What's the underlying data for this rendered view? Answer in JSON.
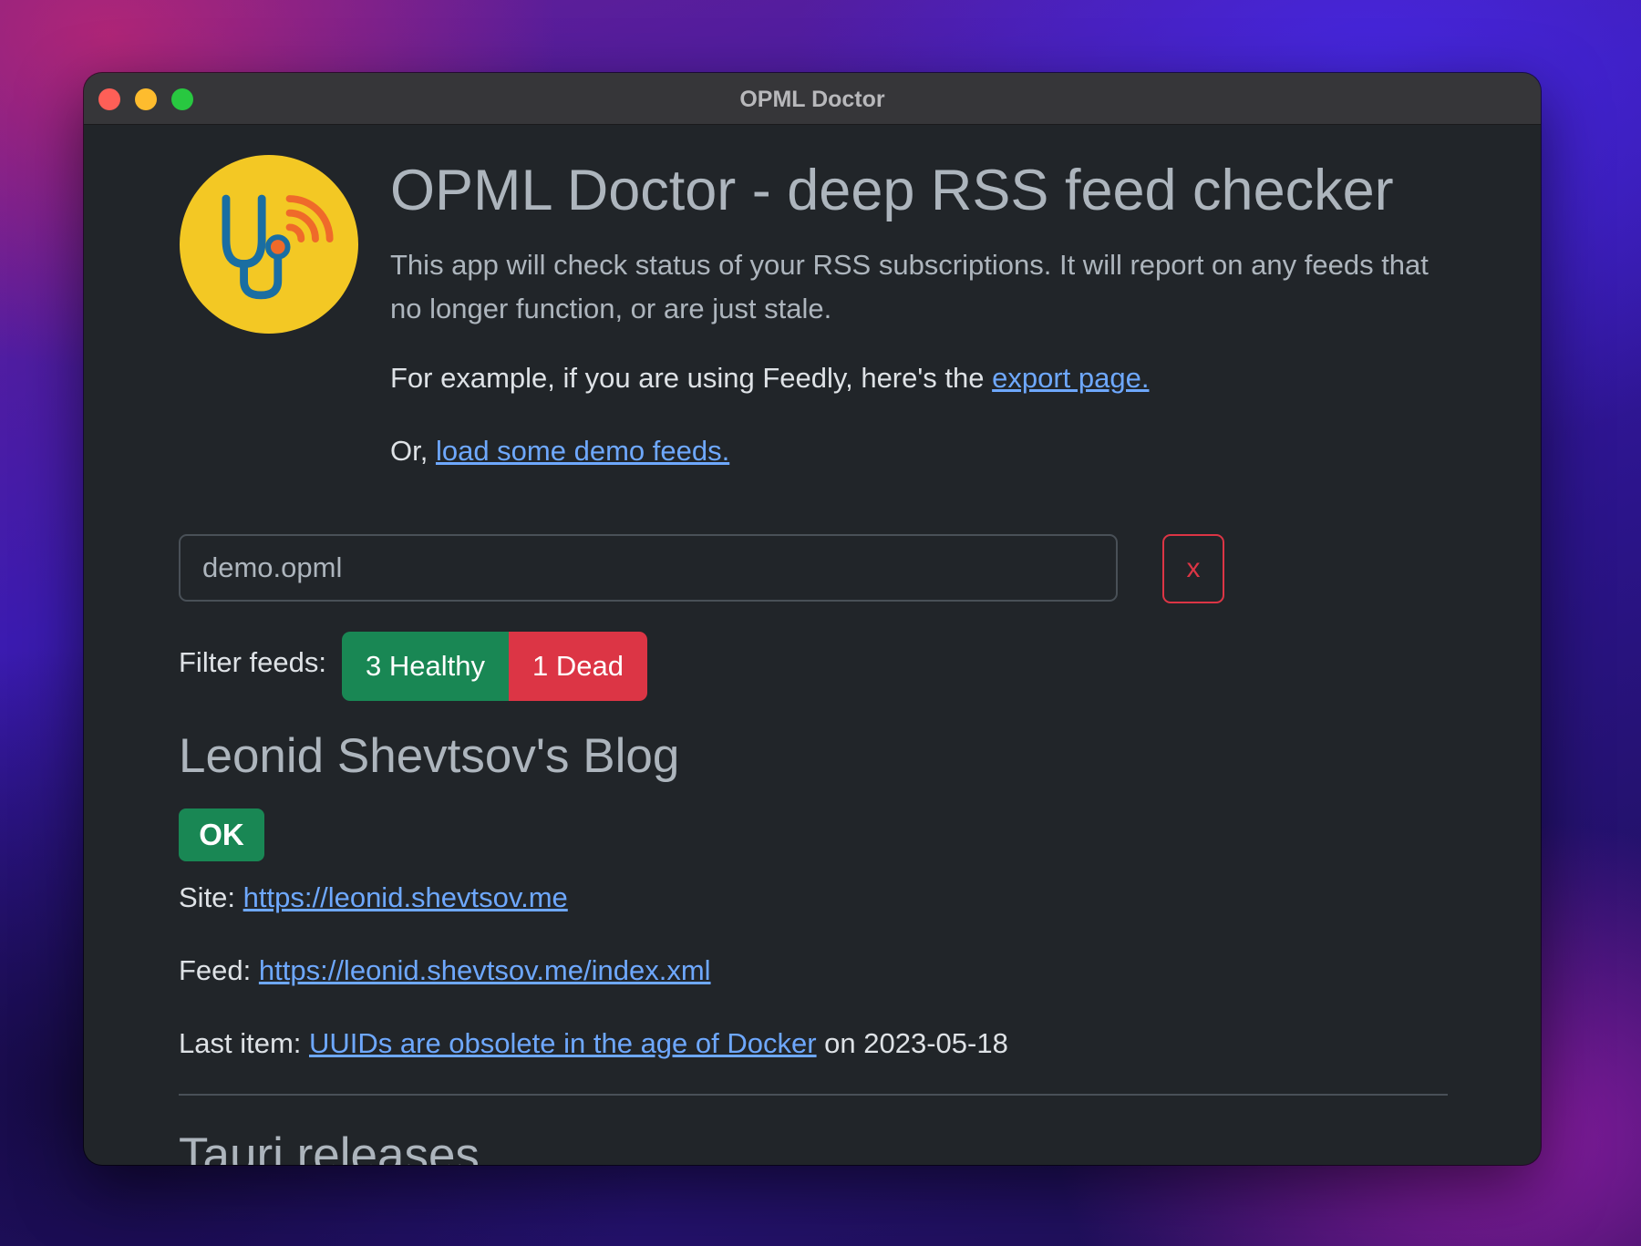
{
  "window": {
    "title": "OPML Doctor"
  },
  "header": {
    "title": "OPML Doctor - deep RSS feed checker",
    "description": "This app will check status of your RSS subscriptions. It will report on any feeds that no longer function, or are just stale.",
    "example_prefix": "For example, if you are using Feedly, here's the ",
    "example_link": "export page.",
    "demo_prefix": "Or, ",
    "demo_link": "load some demo feeds."
  },
  "file_input": {
    "value": "demo.opml",
    "clear_label": "x"
  },
  "filter": {
    "label": "Filter feeds:",
    "healthy_label": "3 Healthy",
    "dead_label": "1 Dead"
  },
  "feeds": [
    {
      "title": "Leonid Shevtsov's Blog",
      "status": "OK",
      "site_label": "Site: ",
      "site_url": "https://leonid.shevtsov.me",
      "feed_label": "Feed: ",
      "feed_url": "https://leonid.shevtsov.me/index.xml",
      "last_item_label": "Last item: ",
      "last_item_title": "UUIDs are obsolete in the age of Docker",
      "last_item_date": " on 2023-05-18"
    },
    {
      "title": "Tauri releases"
    }
  ],
  "colors": {
    "background": "#212529",
    "link": "#6ea8fe",
    "success": "#198754",
    "danger": "#dc3545",
    "logo_yellow": "#f3c824",
    "logo_blue": "#1a6ea2",
    "logo_orange": "#ef6a2a"
  },
  "icons": {
    "logo": "stethoscope-rss-icon"
  }
}
